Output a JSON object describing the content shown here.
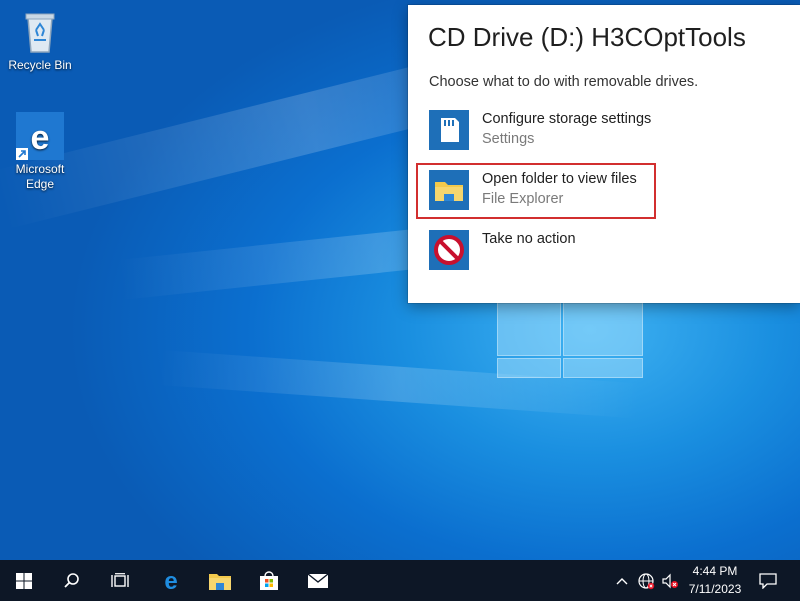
{
  "desktop": {
    "icons": [
      {
        "label": "Recycle Bin",
        "icon": "recycle-bin-icon"
      },
      {
        "label": "Microsoft Edge",
        "icon": "edge-icon"
      }
    ]
  },
  "autoplay": {
    "title": "CD Drive (D:) H3COptTools",
    "subtitle": "Choose what to do with removable drives.",
    "options": [
      {
        "label": "Configure storage settings",
        "sub": "Settings",
        "icon": "storage-settings-icon",
        "selected": false
      },
      {
        "label": "Open folder to view files",
        "sub": "File Explorer",
        "icon": "folder-icon",
        "selected": true
      },
      {
        "label": "Take no action",
        "sub": "",
        "icon": "no-action-icon",
        "selected": false
      }
    ]
  },
  "taskbar": {
    "buttons": [
      {
        "name": "start-button",
        "icon": "windows-logo-icon"
      },
      {
        "name": "search-button",
        "icon": "search-icon"
      },
      {
        "name": "task-view-button",
        "icon": "task-view-icon"
      },
      {
        "name": "edge-taskbar-button",
        "icon": "edge-icon"
      },
      {
        "name": "file-explorer-taskbar-button",
        "icon": "folder-icon"
      },
      {
        "name": "store-taskbar-button",
        "icon": "store-icon"
      },
      {
        "name": "mail-taskbar-button",
        "icon": "mail-icon"
      }
    ],
    "tray": {
      "time": "4:44 PM",
      "date": "7/11/2023"
    }
  },
  "colors": {
    "accent": "#1e6fb8",
    "selection_outline": "#d22f2f",
    "taskbar": "#0d1726"
  }
}
